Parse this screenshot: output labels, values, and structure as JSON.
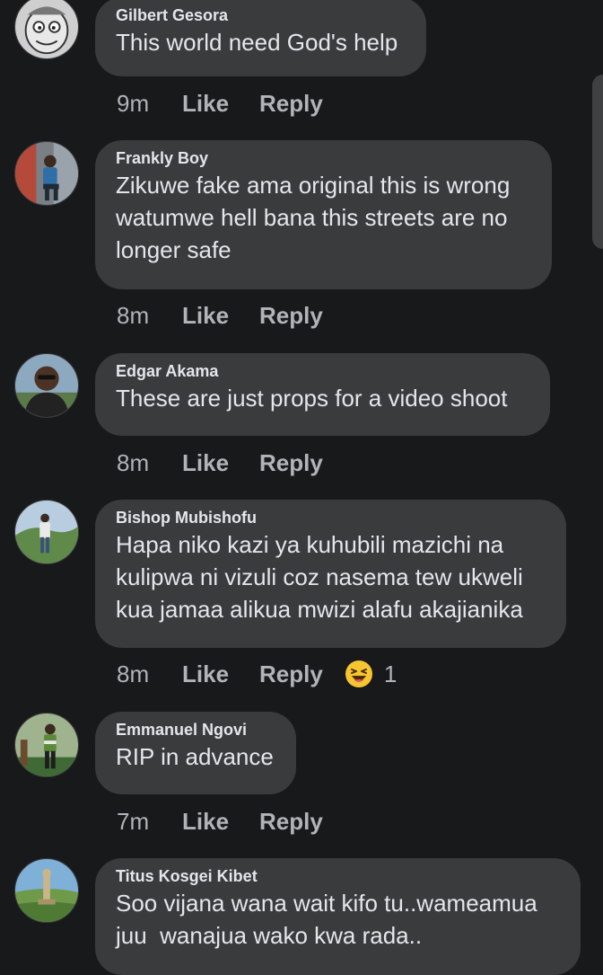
{
  "comments": [
    {
      "author": "Gilbert Gesora",
      "text_lines": [
        "This world need God's help"
      ],
      "time": "9m",
      "like_label": "Like",
      "reply_label": "Reply",
      "avatar": "cartoon-face-avatar"
    },
    {
      "author": "Frankly Boy",
      "text_lines": [
        "Zikuwe fake ama original this is wrong",
        "watumwe hell bana this streets are no",
        "longer safe"
      ],
      "time": "8m",
      "like_label": "Like",
      "reply_label": "Reply",
      "avatar": "man-sitting-avatar"
    },
    {
      "author": "Edgar Akama",
      "text_lines": [
        "These are just props for a video shoot"
      ],
      "time": "8m",
      "like_label": "Like",
      "reply_label": "Reply",
      "avatar": "man-portrait-avatar"
    },
    {
      "author": "Bishop Mubishofu",
      "text_lines": [
        "Hapa niko kazi ya kuhubili mazichi na",
        "kulipwa ni vizuli coz nasema tew ukweli",
        "kua jamaa alikua mwizi alafu akajianika"
      ],
      "time": "8m",
      "like_label": "Like",
      "reply_label": "Reply",
      "avatar": "man-landscape-avatar",
      "reaction": {
        "icon": "laughing-emoji-icon",
        "count": "1"
      }
    },
    {
      "author": "Emmanuel Ngovi",
      "text_lines": [
        "RIP in advance"
      ],
      "time": "7m",
      "like_label": "Like",
      "reply_label": "Reply",
      "avatar": "man-outdoor-avatar"
    },
    {
      "author": "Titus Kosgei Kibet",
      "text_lines": [
        "Soo vijana wana wait kifo tu..wameamua",
        "juu  wanajua wako kwa rada.."
      ],
      "avatar": "statue-landscape-avatar"
    }
  ],
  "colors": {
    "background": "#18191a",
    "bubble": "#3a3b3c",
    "text": "#e4e6eb",
    "secondary_text": "#b0b3b8"
  }
}
